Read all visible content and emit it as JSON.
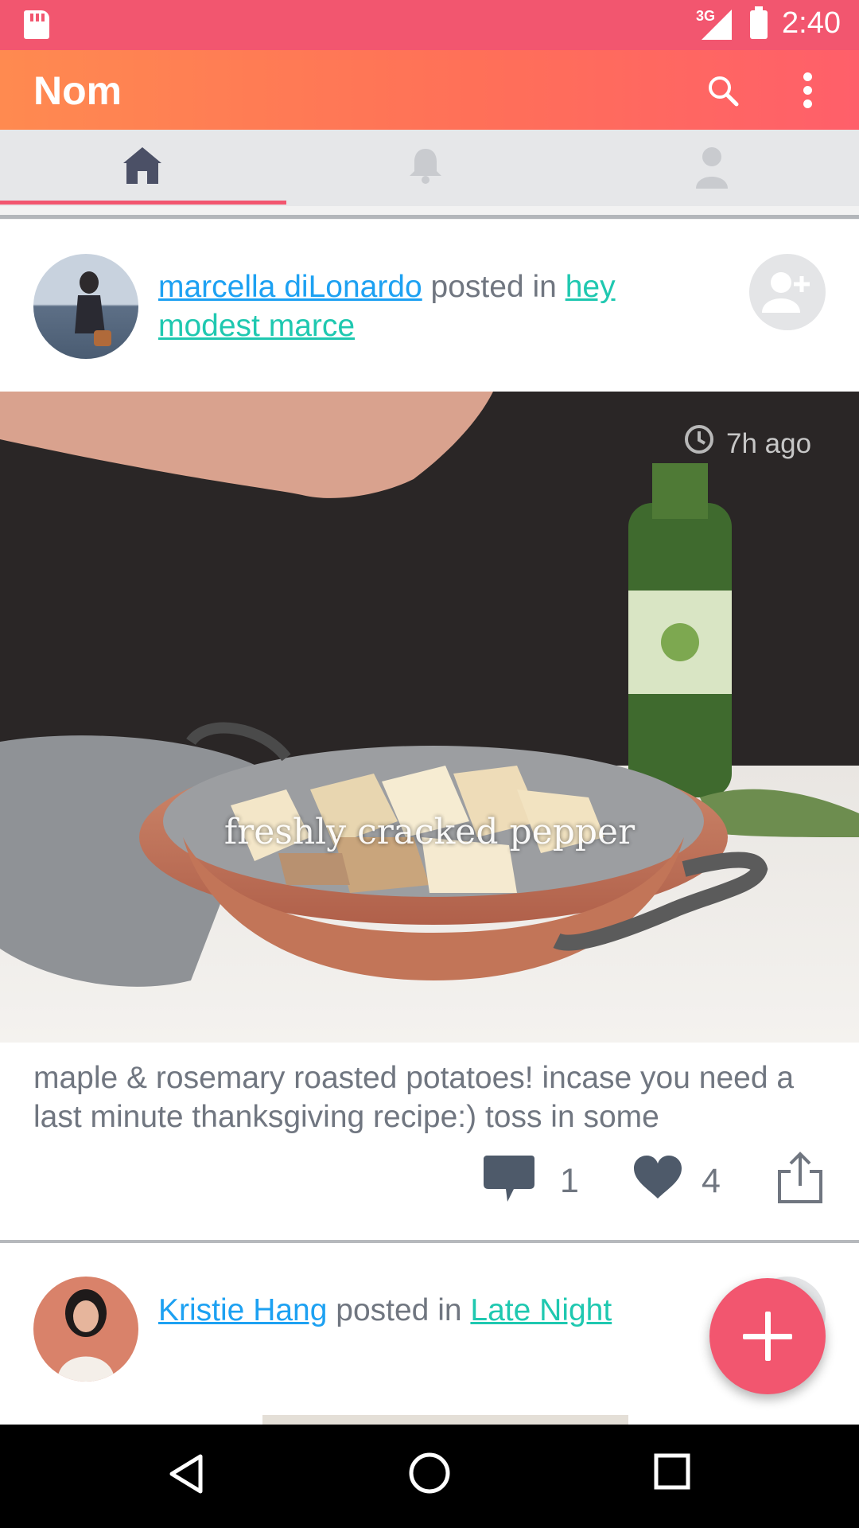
{
  "status_bar": {
    "network": "3G",
    "time": "2:40"
  },
  "app_bar": {
    "title": "Nom",
    "actions": [
      "search-icon",
      "more-vert-icon"
    ]
  },
  "tabs": [
    {
      "name": "home",
      "icon": "home-icon",
      "selected": true
    },
    {
      "name": "notifications",
      "icon": "bell-icon",
      "selected": false
    },
    {
      "name": "profile",
      "icon": "person-icon",
      "selected": false
    }
  ],
  "posts": [
    {
      "author": "marcella diLonardo",
      "connector": "posted in",
      "group": "hey modest marce",
      "timestamp": "7h ago",
      "photo_caption": "freshly cracked pepper",
      "text": "maple & rosemary roasted potatoes! incase you need a last minute thanksgiving recipe:) toss in some",
      "comments": "1",
      "likes": "4"
    },
    {
      "author": "Kristie Hang",
      "connector": "posted in",
      "group": "Late Night"
    }
  ],
  "fab": {
    "icon": "plus-icon"
  },
  "nav_bar": {
    "buttons": [
      "back-icon",
      "home-circle-icon",
      "recents-icon"
    ]
  },
  "colors": {
    "accent": "#f2566f",
    "user_link": "#1da1f2",
    "group_link": "#1fc8b0",
    "text": "#707680"
  }
}
